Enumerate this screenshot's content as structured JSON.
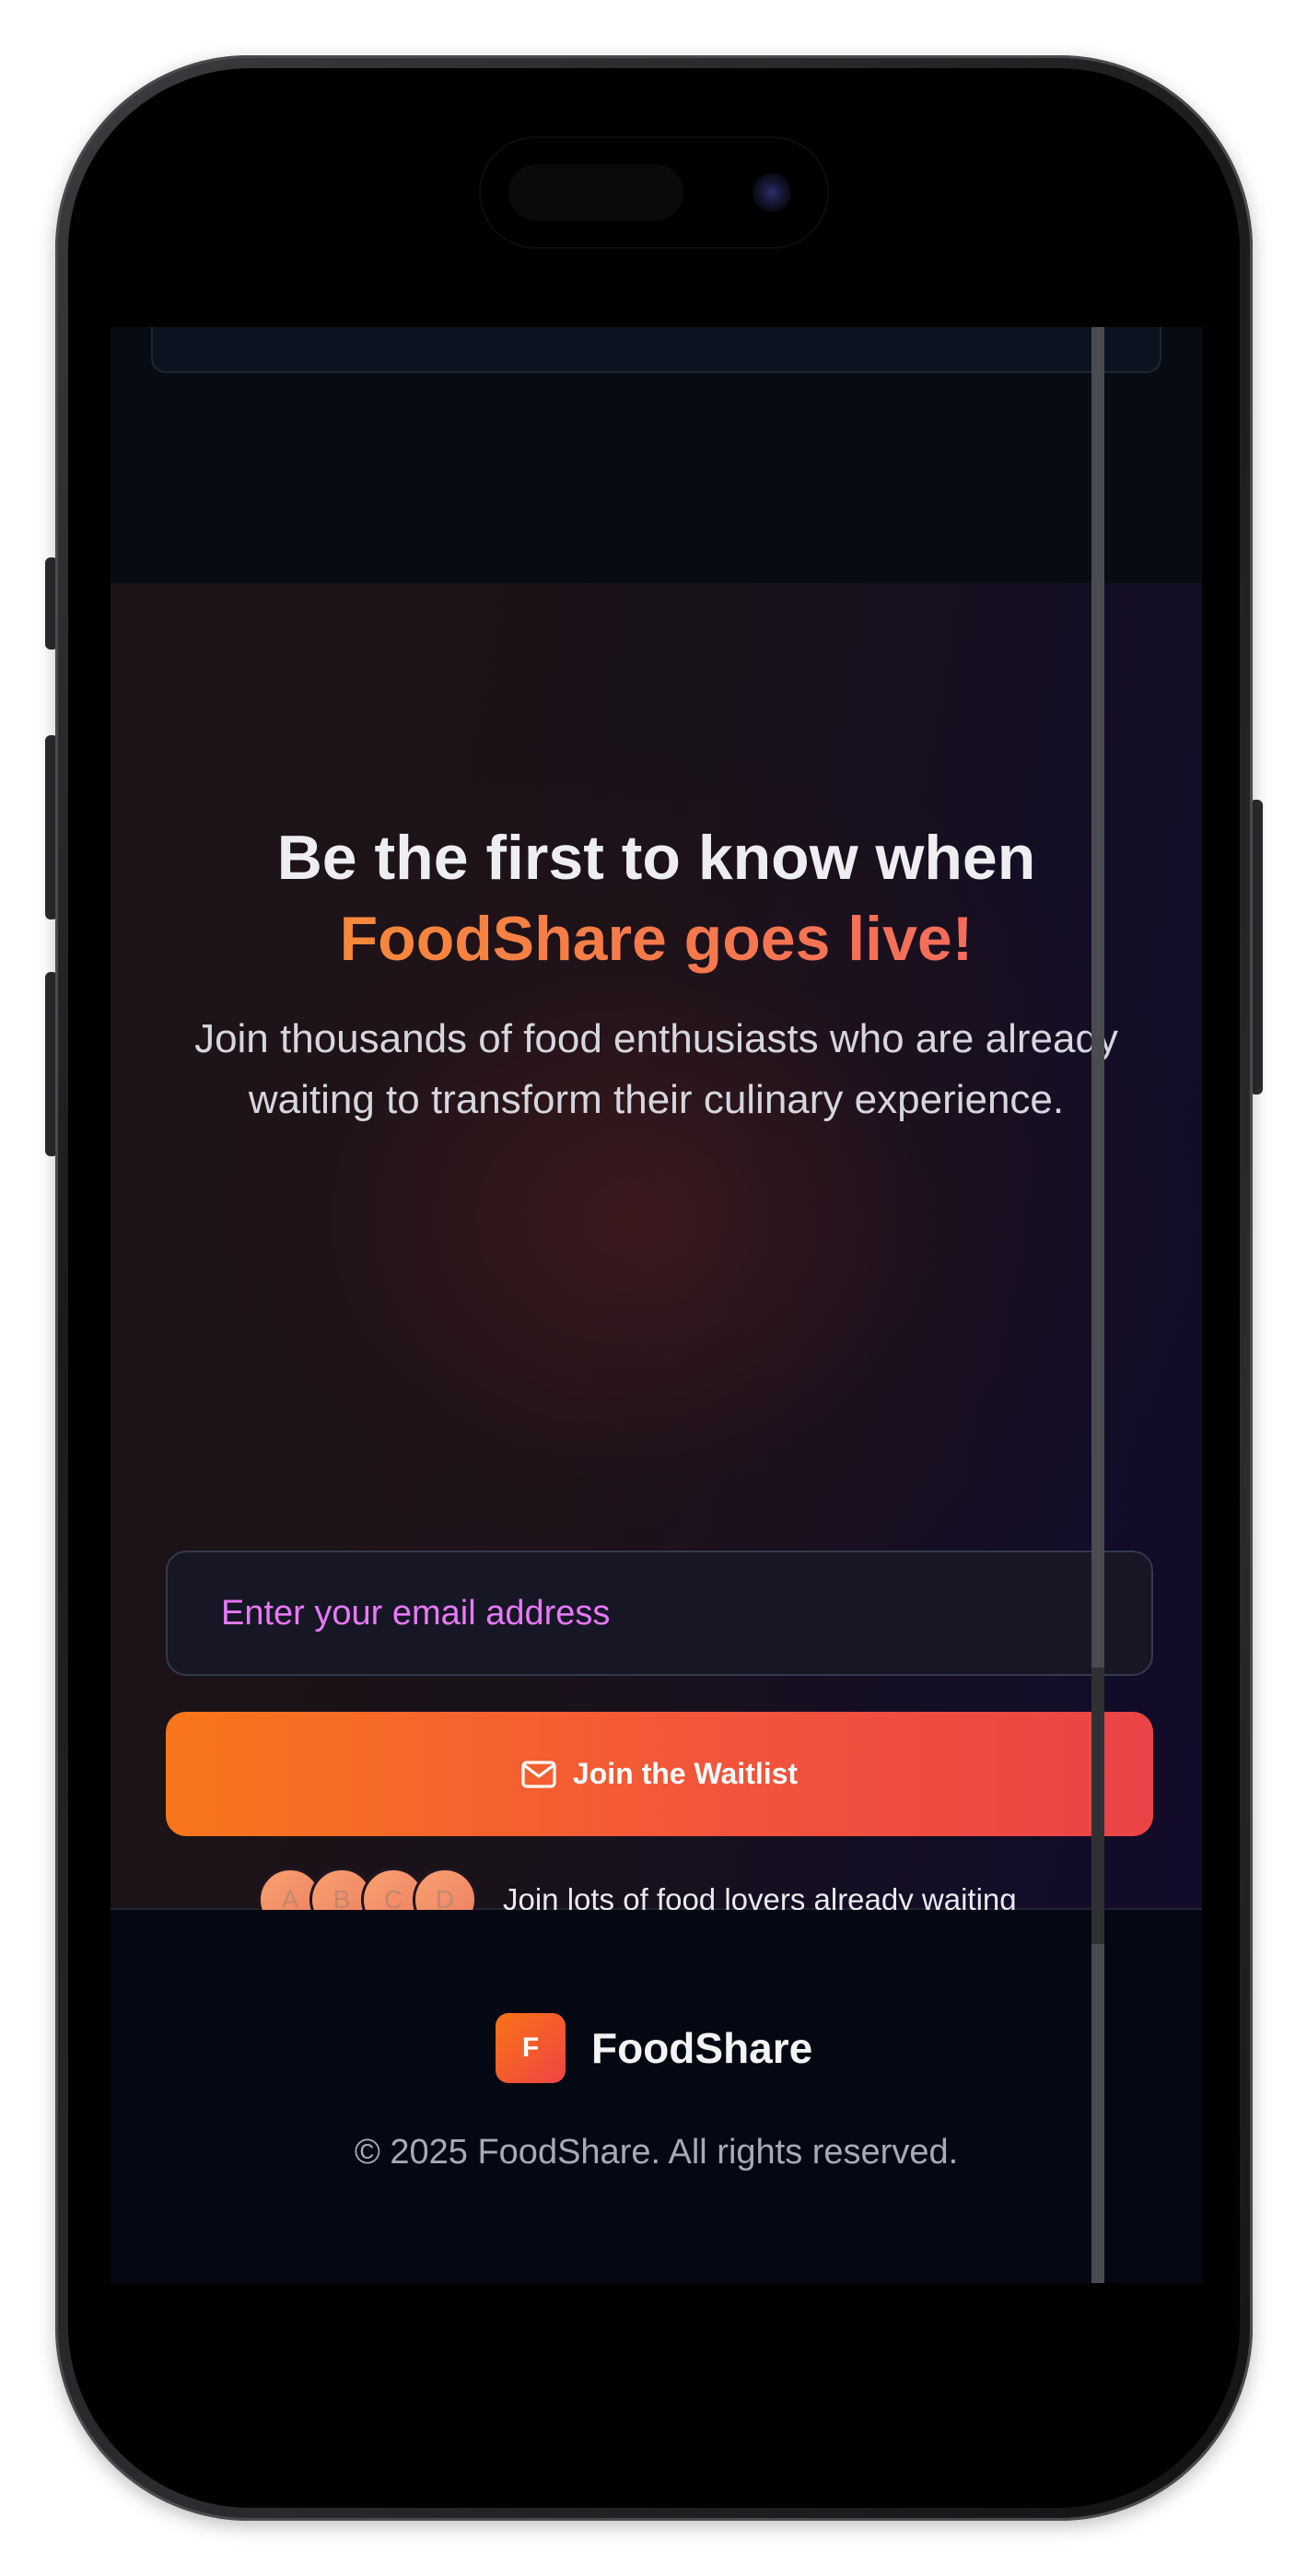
{
  "waitlist": {
    "headline_line1": "Be the first to know when",
    "headline_accent": "FoodShare goes live!",
    "subtext": "Join thousands of food enthusiasts who are already waiting to transform their culinary experience.",
    "email_placeholder": "Enter your email address",
    "join_button_label": "Join the Waitlist",
    "avatars": [
      "A",
      "B",
      "C",
      "D"
    ],
    "social_proof_text": "Join lots of food lovers already waiting"
  },
  "footer": {
    "logo_letter": "F",
    "brand_name": "FoodShare",
    "copyright": "© 2025 FoodShare. All rights reserved."
  },
  "colors": {
    "accent_orange": "#f97316",
    "accent_red": "#ef4444",
    "placeholder_pink": "#e879f9",
    "background_dark": "#070b14"
  },
  "icons": {
    "join_button_icon": "mail-icon",
    "camera": "camera-icon"
  }
}
